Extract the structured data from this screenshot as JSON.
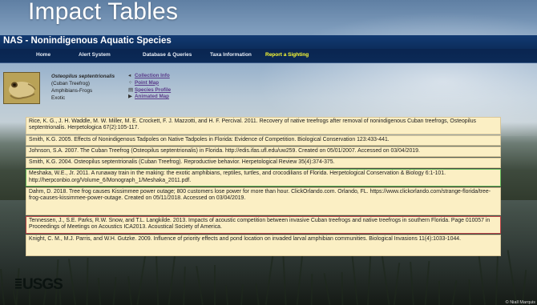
{
  "slide": {
    "title": "Impact Tables",
    "credit": "© Niall Marquis"
  },
  "header": {
    "title": "NAS - Nonindigenous Aquatic Species"
  },
  "nav": {
    "items": [
      {
        "label": "Home"
      },
      {
        "label": "Alert System"
      },
      {
        "label": "Database & Queries"
      },
      {
        "label": "Taxa Information"
      },
      {
        "label": "Report a Sighting",
        "highlighted": true
      }
    ]
  },
  "species": {
    "scientific_name": "Osteopilus septentrionalis",
    "common_name": "(Cuban Treefrog)",
    "group": "Amphibians-Frogs",
    "status": "Exotic",
    "links": [
      {
        "label": "Collection Info",
        "icon": "arrow-icon"
      },
      {
        "label": "Point Map",
        "icon": "map-icon"
      },
      {
        "label": "Species Profile",
        "icon": "profile-icon"
      },
      {
        "label": "Animated Map",
        "icon": "play-icon"
      }
    ]
  },
  "references": [
    "Rice, K. G., J. H. Waddle, M. W. Miller, M. E. Crockett, F. J. Mazzotti, and H. F. Percival. 2011. Recovery of native treefrogs after removal of nonindigenous Cuban treefrogs, Osteopilus septentrionalis. Herpetologica 67(2):105-117.",
    "Smith, K.G. 2005. Effects of Nonindigenous Tadpoles on Native Tadpoles in Florida: Evidence of Competition. Biological Conservation 123:433-441.",
    "Johnson, S.A. 2007. The Cuban Treefrog (Osteopilus septentrionalis) in Florida. http://edis.ifas.ufl.edu/uw259. Created on 05/01/2007. Accessed on 03/04/2019.",
    "Smith, K.G. 2004. Osteopilus septentrionalis (Cuban Treefrog). Reproductive behavior. Herpetological Review 35(4):374-375.",
    "Meshaka, W.E., Jr. 2011. A runaway train in the making: the exotic amphibians, reptiles, turtles, and crocodilians of Florida. Herpetological Conservation & Biology 6:1-101. http://herpconbio.org/Volume_6/Monograph_1/Meshaka_2011.pdf.",
    "Dahm, D. 2018. Tree frog causes Kissimmee power outage; 800 customers lose power for more than hour. ClickOrlando.com. Orlando, FL. https://www.clickorlando.com/strange-florida/tree-frog-causes-kissimmee-power-outage. Created on 05/11/2018. Accessed on 03/04/2019.",
    "Tennessen, J., S.E. Parks, R.W. Snow, and T.L. Langkilde. 2013. Impacts of acoustic competition between invasive Cuban treefrogs and native treefrogs in southern Florida. Page 010057 in Proceedings of Meetings on Acoustics ICA2013. Acoustical Society of America.",
    "Knight, C. M., M.J. Parris, and W.H. Gutzke. 2009. Influence of priority effects and pond location on invaded larval amphibian communities. Biological Invasions 11(4):1033-1044."
  ],
  "footer": {
    "logo": "USGS"
  },
  "colors": {
    "header": "#0c2d5c",
    "highlight": "#ffff33",
    "ref_bg": "#fbefc4",
    "link": "#5a3b8a"
  }
}
